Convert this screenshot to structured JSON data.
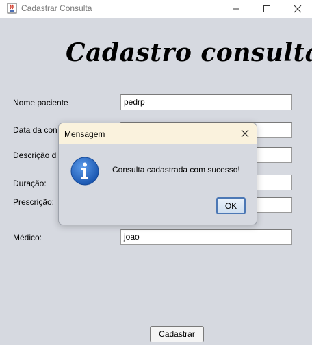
{
  "window": {
    "title": "Cadastrar Consulta",
    "app_icon": "java-cup-icon",
    "controls": [
      "minimize-icon",
      "maximize-icon",
      "close-icon"
    ]
  },
  "form": {
    "heading": "Cadastro consulta",
    "fields": [
      {
        "label": "Nome paciente",
        "value": "pedrp"
      },
      {
        "label": "Data da con",
        "value": ""
      },
      {
        "label": "Descrição d",
        "value": ""
      },
      {
        "label": "Duração:",
        "value": ""
      },
      {
        "label": "Prescrição:",
        "value": ""
      },
      {
        "label": "Médico:",
        "value": "joao"
      }
    ],
    "submit_label": "Cadastrar"
  },
  "dialog": {
    "title": "Mensagem",
    "icon": "information-icon",
    "message": "Consulta cadastrada com sucesso!",
    "ok_label": "OK",
    "close_icon": "close-icon"
  },
  "colors": {
    "window_background": "#d6d9e0",
    "dialog_titlebar": "#faf2dd",
    "info_icon_blue": "#2166c4",
    "ok_border": "#4c78b5"
  }
}
